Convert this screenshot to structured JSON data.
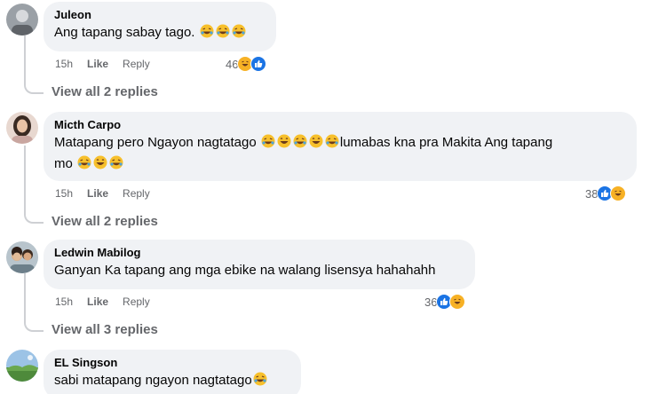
{
  "comments": [
    {
      "author": "Juleon",
      "text": "Ang tapang sabay tago.",
      "text_emoji_count": 3,
      "time": "15h",
      "like_label": "Like",
      "reply_label": "Reply",
      "reaction_count": "46",
      "view_replies": "View all 2 replies",
      "avatar_icon": "grey-profile-photo"
    },
    {
      "author": "Micth Carpo",
      "text_line1": "Matapang pero Ngayon nagtatago",
      "text_line1b": "lumabas kna pra Makita Ang tapang",
      "text_line2": "mo",
      "time": "15h",
      "like_label": "Like",
      "reply_label": "Reply",
      "reaction_count": "38",
      "view_replies": "View all 2 replies",
      "avatar_icon": "woman-profile-photo"
    },
    {
      "author": "Ledwin Mabilog",
      "text": "Ganyan Ka tapang ang mga ebike na walang lisensya hahahahh",
      "time": "15h",
      "like_label": "Like",
      "reply_label": "Reply",
      "reaction_count": "36",
      "view_replies": "View all 3 replies",
      "avatar_icon": "couple-profile-photo"
    },
    {
      "author": "EL Singson",
      "text": "sabi matapang ngayon nagtatago",
      "avatar_icon": "landscape-profile-photo"
    }
  ],
  "colors": {
    "bubble": "#f0f2f5",
    "meta_text": "#65676b",
    "like_blue": "#1b74e4",
    "haha_yellow": "#f7b125"
  },
  "icons": [
    "laughing-emoji-icon",
    "like-reaction-icon",
    "haha-reaction-icon"
  ]
}
